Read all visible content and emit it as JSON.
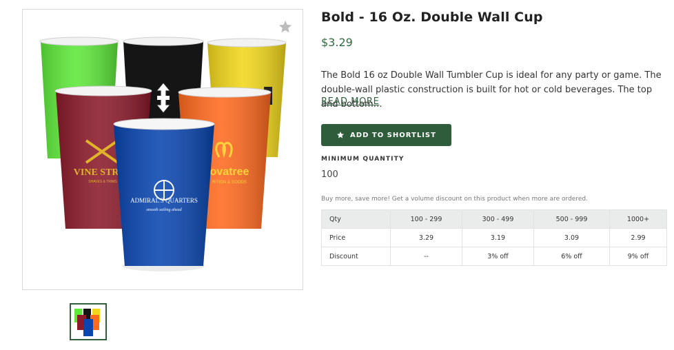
{
  "product": {
    "title": "Bold - 16 Oz. Double Wall Cup",
    "price": "$3.29",
    "description": "The Bold 16 oz Double Wall Tumbler Cup is ideal for any party or game. The double-wall plastic construction is built for hot or cold beverages. The top and bottom…",
    "read_more": "READ MORE",
    "shortlist_button": "ADD TO SHORTLIST",
    "min_quantity_label": "MINIMUM QUANTITY",
    "min_quantity_value": "100",
    "volume_note": "Buy more, save more! Get a volume discount on this product when more are ordered."
  },
  "gallery": {
    "cup_colors": [
      "#5ee83a",
      "#111111",
      "#f1d71b",
      "#8b1a2b",
      "#ff6a1f",
      "#0a46b0"
    ],
    "cup_logos": {
      "red": [
        "VINE STREE",
        "SHAVES & TRIMS"
      ],
      "orange": [
        "ovatree",
        "RITION & GOODS"
      ],
      "blue": [
        "ADMIRAL'S QUARTERS",
        "smooth sailing ahead"
      ]
    }
  },
  "pricing": {
    "headers": [
      "Qty",
      "100 - 299",
      "300 - 499",
      "500 - 999",
      "1000+"
    ],
    "rows": [
      [
        "Price",
        "3.29",
        "3.19",
        "3.09",
        "2.99"
      ],
      [
        "Discount",
        "--",
        "3% off",
        "6% off",
        "9% off"
      ]
    ]
  },
  "colors": {
    "brand_green": "#2f5d3c",
    "price_green": "#2e6b3c"
  }
}
